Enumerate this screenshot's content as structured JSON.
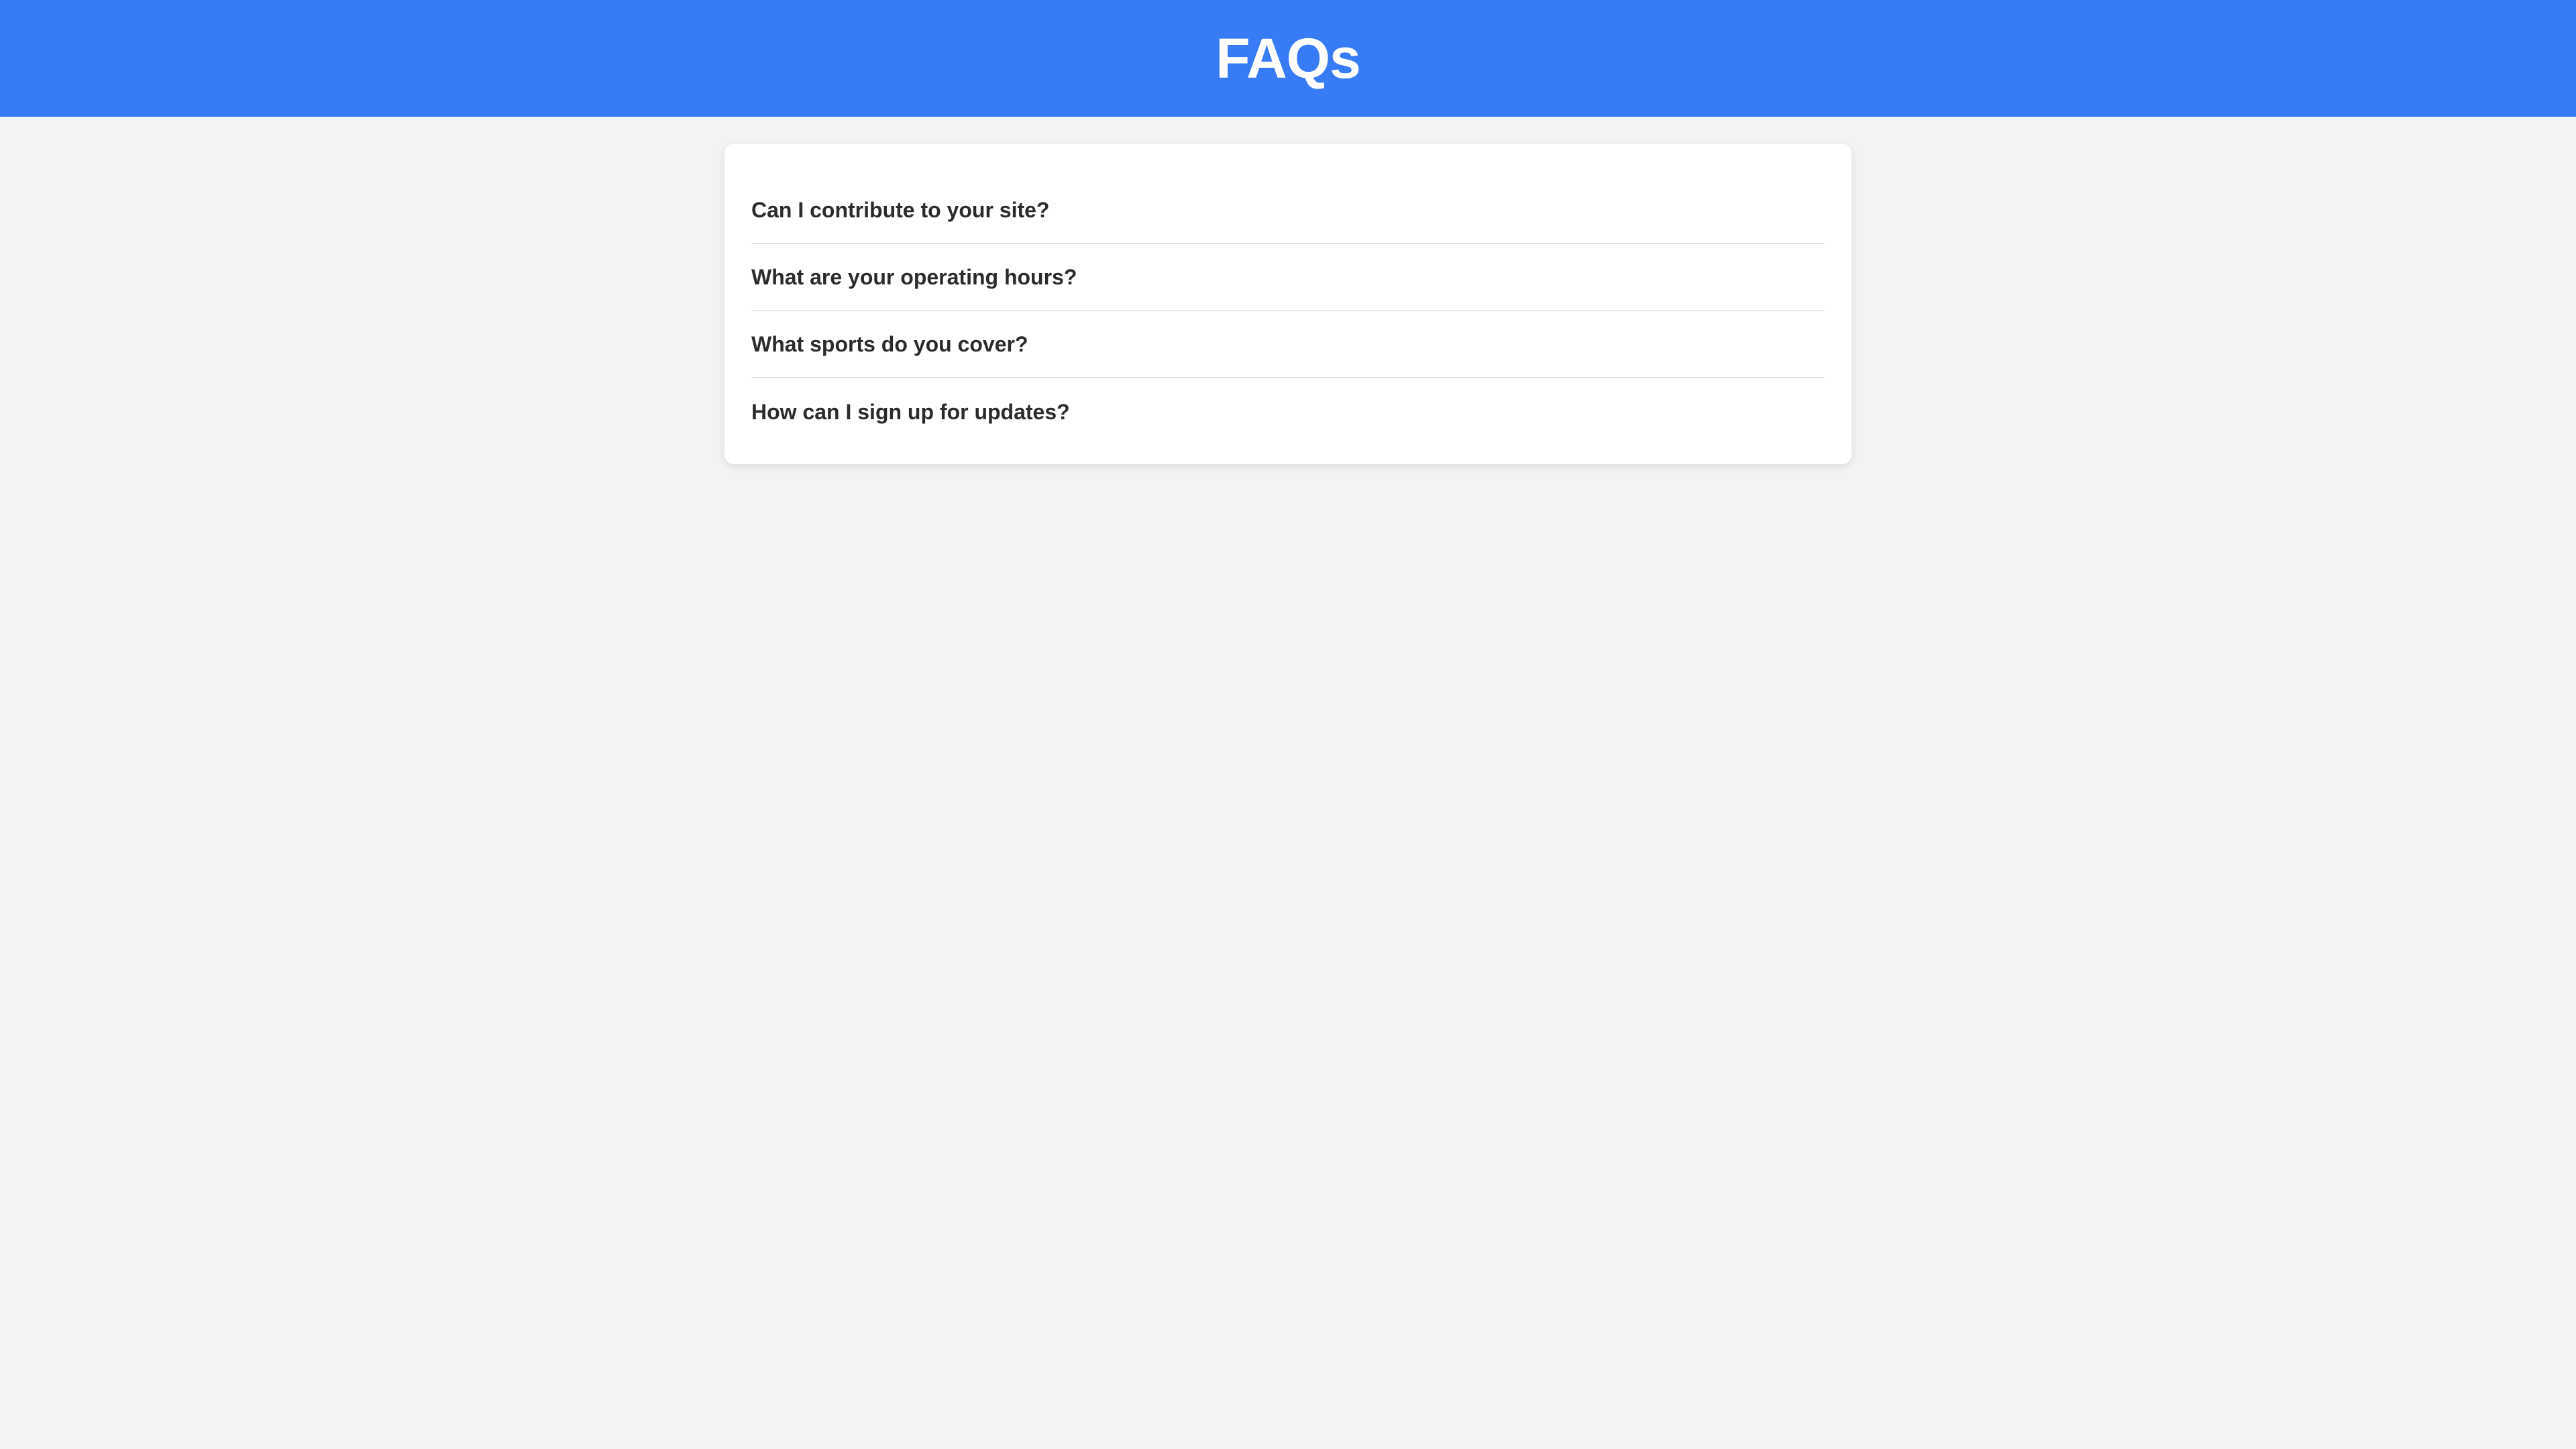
{
  "header": {
    "title": "FAQs"
  },
  "faq": {
    "items": [
      {
        "question": "Can I contribute to your site?"
      },
      {
        "question": "What are your operating hours?"
      },
      {
        "question": "What sports do you cover?"
      },
      {
        "question": "How can I sign up for updates?"
      }
    ]
  },
  "colors": {
    "header_background": "#377bf6",
    "page_background": "#f3f3f3",
    "card_background": "#ffffff",
    "text": "#2b2b2b"
  }
}
